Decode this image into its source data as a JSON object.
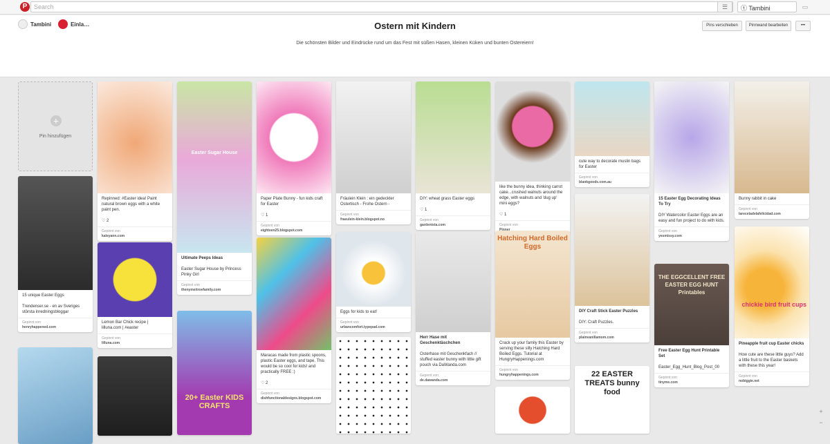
{
  "topbar": {
    "search_placeholder": "Search",
    "user": "Tambini"
  },
  "board": {
    "title": "Ostern mit Kindern",
    "owner": "Tambini",
    "collab": "Einla…",
    "description": "Die schönsten Bilder und Eindrücke rund um das Fest mit süßen Hasen, kleinen Küken und bunten Ostereiern!",
    "btn_move": "Pins verschieben",
    "btn_edit": "Pinnwand bearbeiten",
    "btn_more": "•••"
  },
  "add_pin": "Pin hinzufügen",
  "pins": [
    {
      "text": "Repinned: #Easter idea! Paint natural brown eggs with a white paint pen.",
      "meta": "♡ 2",
      "via": "Gepinnt von",
      "src": "kaleyann.com"
    },
    {
      "text": "Ultimate Peeps Ideas",
      "meta": "Easter Sugar House by Princess Pinky Girl",
      "via": "Gepinnt von",
      "src": "thenymeitroefamily.com"
    },
    {
      "text": "Paper Plate Bunny - fun kids craft for Easter",
      "meta": "♡ 1",
      "via": "Gepinnt von",
      "src": "eighteen25.blogspot.com"
    },
    {
      "text": "Fräulein Klein : ein gedeckter Ostertisch - Frohe Ostern -",
      "meta": "",
      "via": "Gepinnt von",
      "src": "fraeulein-klein.blogspot.no"
    },
    {
      "text": "DIY: wheat grass Easter eggs",
      "meta": "♡ 1",
      "via": "Gepinnt von",
      "src": "gardenista.com"
    },
    {
      "text": "like the bunny idea, thinking carrot cake...crushed walnuts around the edge, with walnuts and 'dug up' mini eggs?",
      "meta": "♡ 1",
      "via": "Gepinnt von",
      "src": "Pinner"
    },
    {
      "text": "cute way to decorate muslin bags for Easter",
      "meta": "",
      "via": "Gepinnt von",
      "src": "blankgoods.com.au"
    },
    {
      "text": "15 Easter Egg Decorating Ideas To Try",
      "meta": "DIY Watercolor Easter Eggs are an easy and fun project to do with kids.",
      "via": "Gepinnt von",
      "src": "yesmissy.com"
    },
    {
      "text": "Bunny rabbit in cake",
      "meta": "",
      "via": "Gepinnt von",
      "src": "larecetadelafelicidad.com"
    },
    {
      "text": "15 unique Easter Eggs",
      "meta": "Trendenser.se - en av Sveriges största inredningsbloggar",
      "via": "Gepinnt von",
      "src": "henryhappened.com"
    },
    {
      "text": "Lemon Bar Chick recipe | lilluna.com | #easter",
      "meta": "",
      "via": "Gepinnt von",
      "src": "lilluna.com"
    },
    {
      "text": "Maracas made from plastic spoons, plastic Easter eggs, and tape. This would be so cool for kids! and practically FREE :)",
      "meta": "♡ 2",
      "via": "Gepinnt von",
      "src": "dishfunctionaldesigns.blogspot.com"
    },
    {
      "text": "Eggs for kids to eat!",
      "meta": "",
      "via": "Gepinnt von",
      "src": "urbancomfort.typepad.com"
    },
    {
      "text": "Herr Hase mit Geschenktäschchen",
      "meta": "Osterhase mit Geschenkfach // stuffed easter bunny with little gift pouch via DaWanda.com",
      "via": "Gepinnt von",
      "src": "de.dawanda.com"
    },
    {
      "text": "Crack up your family this Easter by serving these silly Hatching Hard Boiled Eggs. Tutorial at HungryHappenings.com",
      "meta": "",
      "via": "Gepinnt von",
      "src": "hungryhappenings.com"
    },
    {
      "text": "DIY Craft Stick Easter Puzzles",
      "meta": "DIY: Craft Puzzles.",
      "via": "Gepinnt von",
      "src": "plainvanillamom.com"
    },
    {
      "text": "Free Easter Egg Hunt Printable Set",
      "meta": "Easter_Egg_Hunt_Blog_Post_00",
      "via": "Gepinnt von",
      "src": "tinyme.com"
    },
    {
      "text": "Pineapple fruit cup Easter chicks",
      "meta": "How cute are these little guys? Add a little fruit to the Easter baskets with these this year!",
      "via": "Gepinnt von",
      "src": "nobiggie.net"
    }
  ],
  "overlay_text": {
    "hatching": "Hatching Hard Boiled Eggs",
    "treats": "22 EASTER TREATS bunny food",
    "hunt": "THE EGGCELLENT FREE EASTER EGG HUNT Printables",
    "kids": "20+ Easter KIDS CRAFTS",
    "chickie": "chickie bird fruit cups",
    "sugar": "Easter Sugar House"
  },
  "colors": {
    "brand": "#cb2027",
    "bg": "#e9e9e9"
  }
}
